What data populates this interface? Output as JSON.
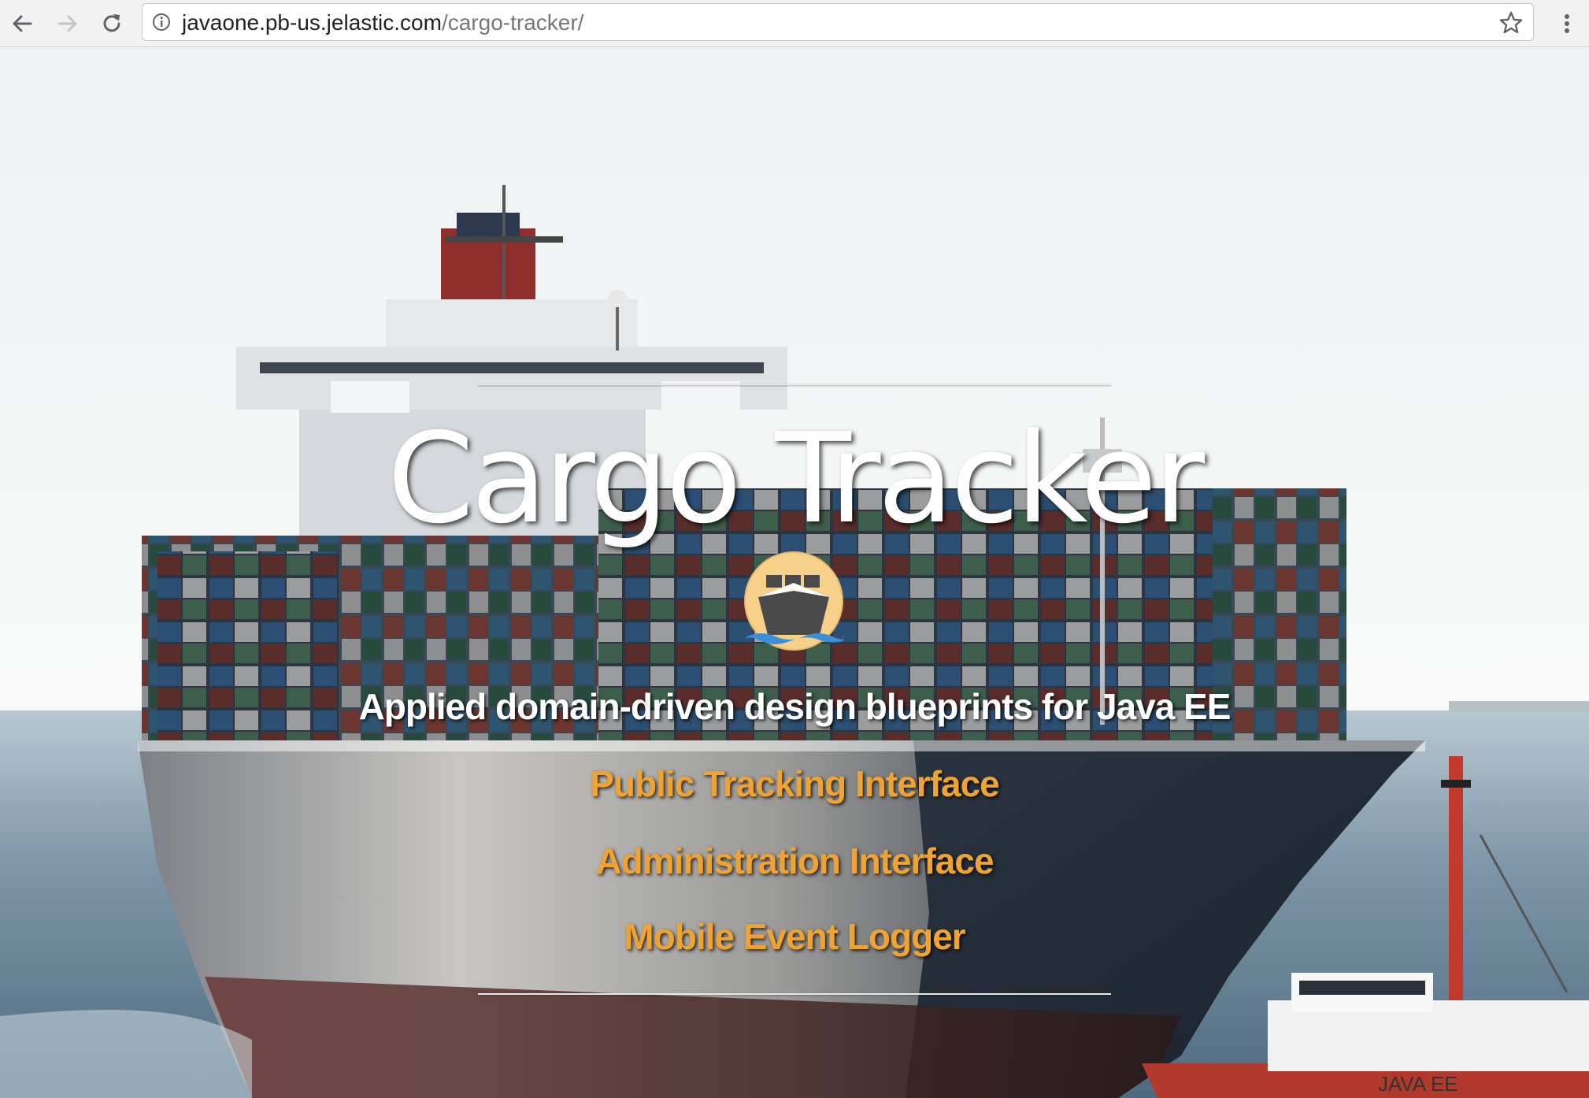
{
  "browser": {
    "url_host": "javaone.pb-us.jelastic.com",
    "url_path": "/cargo-tracker/"
  },
  "hero": {
    "title": "Cargo Tracker",
    "subtitle": "Applied domain-driven design blueprints for Java EE",
    "links": [
      "Public Tracking Interface",
      "Administration Interface",
      "Mobile Event Logger"
    ],
    "tug_lettering": "JAVA EE"
  },
  "colors": {
    "link": "#f0a335",
    "title": "#ffffff",
    "logo_circle": "#f7d08a",
    "logo_ship": "#4a4a4a",
    "logo_wave": "#3b8fd6"
  },
  "icons": {
    "back": "arrow-left",
    "forward": "arrow-right",
    "reload": "reload",
    "info": "info-circle",
    "bookmark": "star-outline",
    "menu": "vertical-ellipsis",
    "logo": "cargo-ship"
  }
}
